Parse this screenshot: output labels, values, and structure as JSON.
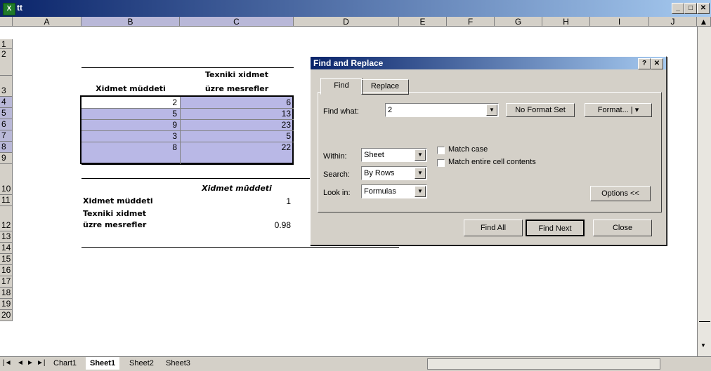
{
  "window": {
    "title": "tt",
    "app_icon": "excel-icon"
  },
  "columns": [
    "A",
    "B",
    "C",
    "D",
    "E",
    "F",
    "G",
    "H",
    "I",
    "J"
  ],
  "rows": [
    "1",
    "2",
    "3",
    "4",
    "5",
    "6",
    "7",
    "8",
    "9",
    "10",
    "11",
    "12",
    "13",
    "14",
    "15",
    "16",
    "17",
    "18",
    "19",
    "20"
  ],
  "table": {
    "header_b": "Xidmet müddeti",
    "header_c_line1": "Texniki xidmet",
    "header_c_line2": "üzre mesrefler",
    "data": [
      {
        "b": "2",
        "c": "6"
      },
      {
        "b": "5",
        "c": "13"
      },
      {
        "b": "9",
        "c": "23"
      },
      {
        "b": "3",
        "c": "5"
      },
      {
        "b": "8",
        "c": "22"
      }
    ],
    "row10_c": "Xidmet müddeti",
    "row11_b": "Xidmet müddeti",
    "row11_c": "1",
    "row12_b_line1": "Texniki xidmet",
    "row12_b_line2": "üzre mesrefler",
    "row12_c": "0.98"
  },
  "sheet_tabs": [
    "Chart1",
    "Sheet1",
    "Sheet2",
    "Sheet3"
  ],
  "dialog": {
    "title": "Find and Replace",
    "help": "?",
    "close": "✕",
    "tab_find": "Find",
    "tab_replace": "Replace",
    "find_what_label": "Find what:",
    "find_what_value": "2",
    "no_format": "No Format Set",
    "format_button": "Format...",
    "within_label": "Within:",
    "within_value": "Sheet",
    "search_label": "Search:",
    "search_value": "By Rows",
    "lookin_label": "Look in:",
    "lookin_value": "Formulas",
    "match_case": "Match case",
    "match_entire": "Match entire cell contents",
    "options_button": "Options <<",
    "find_all": "Find All",
    "find_next": "Find Next",
    "close_button": "Close"
  },
  "colors": {
    "title_start": "#0a246a",
    "selection": "#b9b8e6",
    "chrome": "#d4d0c8"
  }
}
